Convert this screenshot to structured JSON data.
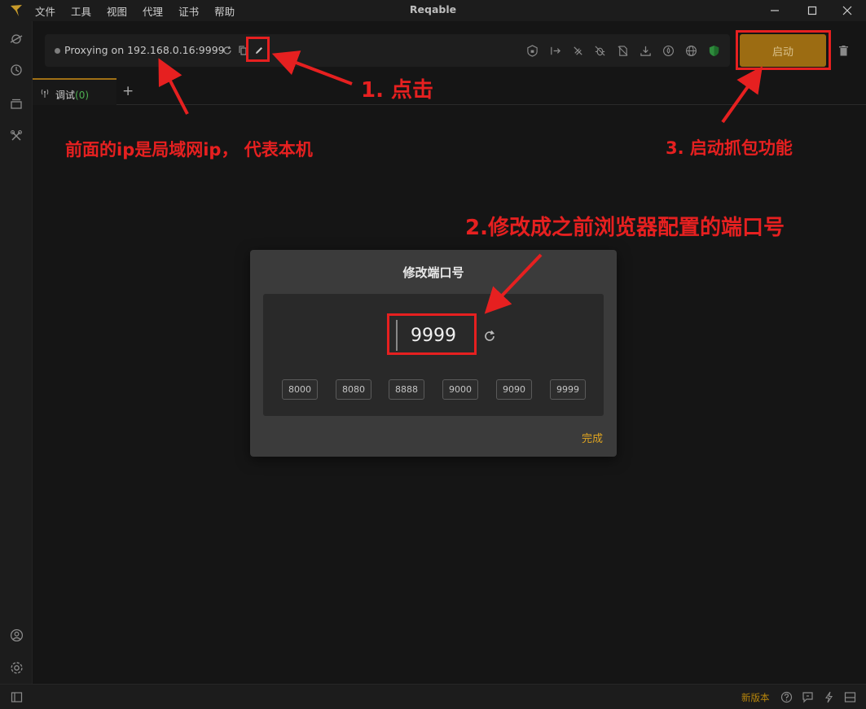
{
  "app": {
    "title": "Reqable",
    "menu": [
      "文件",
      "工具",
      "视图",
      "代理",
      "证书",
      "帮助"
    ]
  },
  "toolbar": {
    "proxy_status": "Proxying on 192.168.0.16:9999",
    "start_label": "启动"
  },
  "tabs": [
    {
      "label": "调试",
      "count": "(0)"
    }
  ],
  "dialog": {
    "title": "修改端口号",
    "port_value": "9999",
    "presets": [
      "8000",
      "8080",
      "8888",
      "9000",
      "9090",
      "9999"
    ],
    "done_label": "完成"
  },
  "statusbar": {
    "new_version": "新版本"
  },
  "annotations": {
    "step1": "1. 点击",
    "ip_note": "前面的ip是局域网ip， 代表本机",
    "step2": "2.修改成之前浏览器配置的端口号",
    "step3": "3. 启动抓包功能"
  },
  "colors": {
    "accent": "#9c6c12",
    "annotation": "#e62020",
    "success": "#4caf50",
    "done": "#e0a520"
  }
}
